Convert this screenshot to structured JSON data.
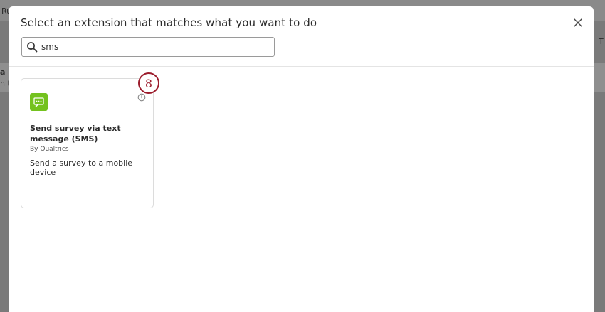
{
  "background": {
    "top_left_text": "Ru",
    "left_text_1": "a",
    "left_text_2": "n tł",
    "right_text": "T"
  },
  "modal": {
    "title": "Select an extension that matches what you want to do",
    "search": {
      "value": "sms",
      "placeholder": ""
    }
  },
  "extensions": [
    {
      "title": "Send survey via text message (SMS)",
      "author": "By Qualtrics",
      "description": "Send a survey to a mobile device",
      "icon": "chat-bubble-icon",
      "icon_color": "#74c21f"
    }
  ],
  "annotation": {
    "step": "8",
    "color": "#9c1c2c"
  }
}
